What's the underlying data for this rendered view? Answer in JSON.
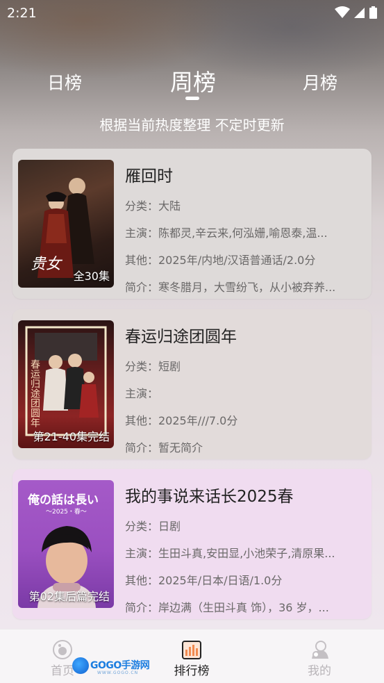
{
  "status_bar": {
    "time": "2:21"
  },
  "tabs": {
    "day": "日榜",
    "week": "周榜",
    "month": "月榜",
    "selected": "周榜"
  },
  "subtitle": "根据当前热度整理 不定时更新",
  "cards": [
    {
      "title": "雁回时",
      "episode_badge": "全30集",
      "category": "分类：大陆",
      "cast": "主演：陈都灵,辛云来,何泓姗,喻恩泰,温...",
      "other": "其他：2025年/内地/汉语普通话/2.0分",
      "intro": "简介：寒冬腊月，大雪纷飞，从小被弃养...",
      "poster_text": "贵女"
    },
    {
      "title": "春运归途团圆年",
      "episode_badge": "第21-40集完结",
      "category": "分类：短剧",
      "cast": "主演：",
      "other": "其他：2025年///7.0分",
      "intro": "简介：暂无简介",
      "poster_text": "春运归途团圆年"
    },
    {
      "title": "我的事说来话长2025春",
      "episode_badge": "第02集后篇完结",
      "category": "分类：日剧",
      "cast": "主演：生田斗真,安田显,小池荣子,清原果...",
      "other": "其他：2025年/日本/日语/1.0分",
      "intro": "简介：岸边满（生田斗真 饰），36 岁，...",
      "poster_text": "俺の話は長い",
      "poster_subtext": "～2025・春～"
    }
  ],
  "bottom_nav": {
    "home": "首页",
    "rank": "排行榜",
    "me": "我的",
    "selected": "排行榜"
  },
  "watermark": {
    "brand": "GOGO手游网",
    "url": "WWW.GOGO.CN"
  },
  "colors": {
    "selected_nav": "#222222",
    "unselected_nav": "#b8b4b8",
    "rank_icon": "#f08a50"
  }
}
